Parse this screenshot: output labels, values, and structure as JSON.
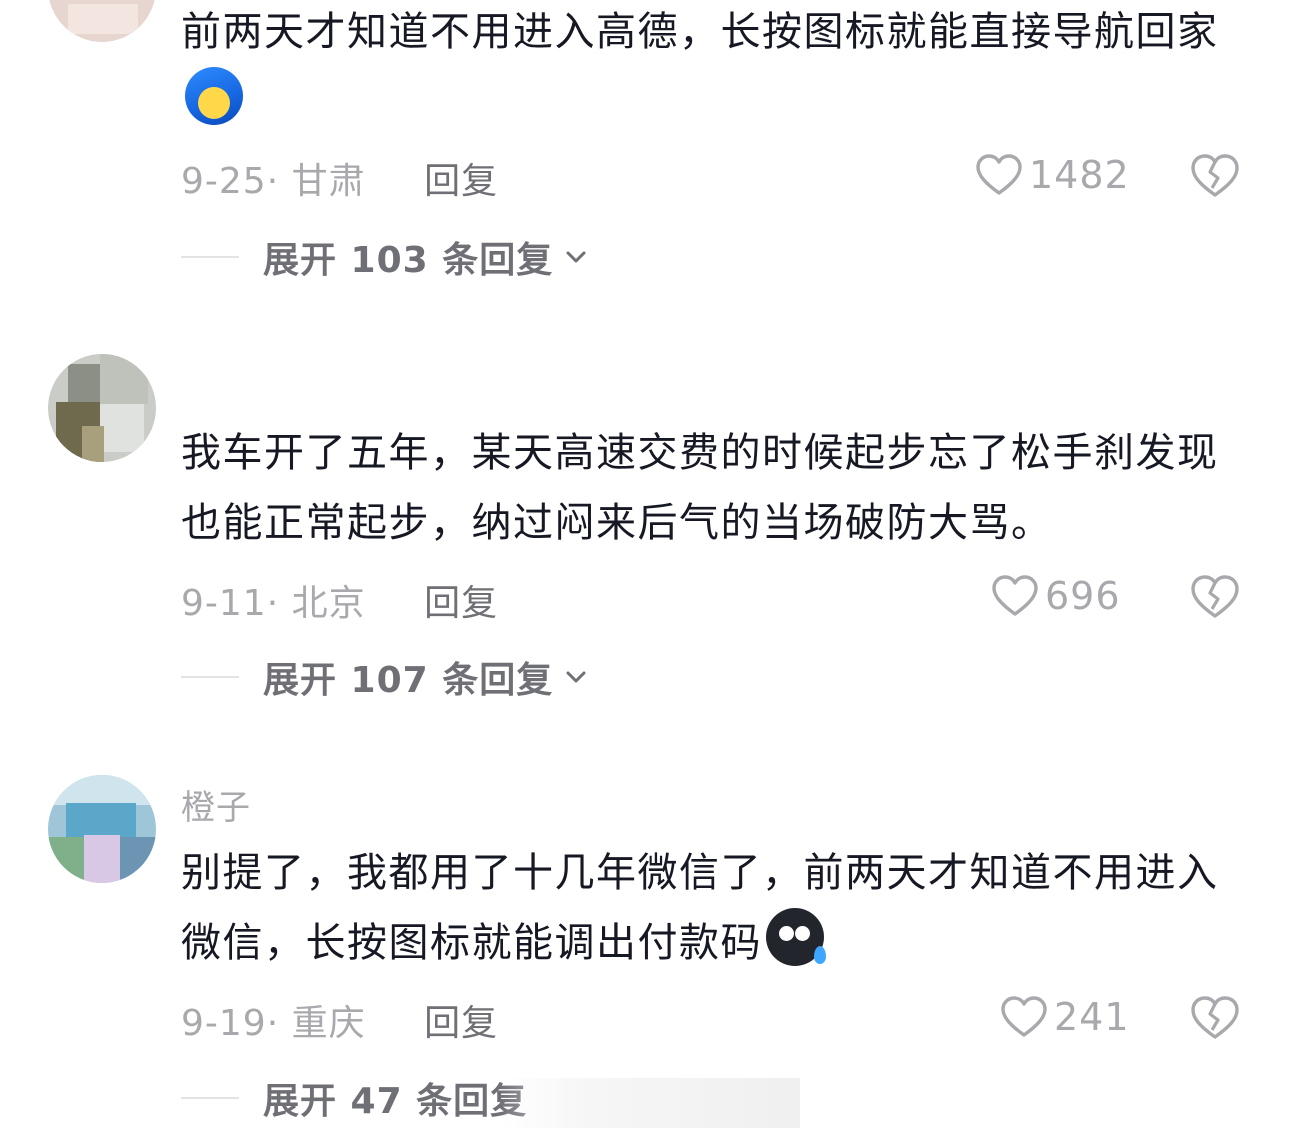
{
  "comments": [
    {
      "username": "",
      "text": "前两天才知道不用进入高德，长按图标就能直接导航回家",
      "emoji": "blue-laughing-emoji",
      "date": "9-25",
      "location": "甘肃",
      "reply_label": "回复",
      "likes": "1482",
      "expand_label": "展开 103 条回复"
    },
    {
      "username": "",
      "text": "我车开了五年，某天高速交费的时候起步忘了松手刹发现也能正常起步，纳过闷来后气的当场破防大骂。",
      "emoji": "",
      "date": "9-11",
      "location": "北京",
      "reply_label": "回复",
      "likes": "696",
      "expand_label": "展开 107 条回复"
    },
    {
      "username": "橙子",
      "text": "别提了，我都用了十几年微信了，前两天才知道不用进入微信，长按图标就能调出付款码",
      "emoji": "dark-sweat-emoji",
      "date": "9-19",
      "location": "重庆",
      "reply_label": "回复",
      "likes": "241",
      "expand_label": "展开 47 条回复"
    }
  ],
  "icons": {
    "like": "heart-outline-icon",
    "dislike": "broken-heart-icon",
    "expand": "chevron-down-icon"
  },
  "colors": {
    "text_primary": "#161823",
    "text_secondary": "#a8a8ad",
    "text_action": "#6f6f76"
  }
}
